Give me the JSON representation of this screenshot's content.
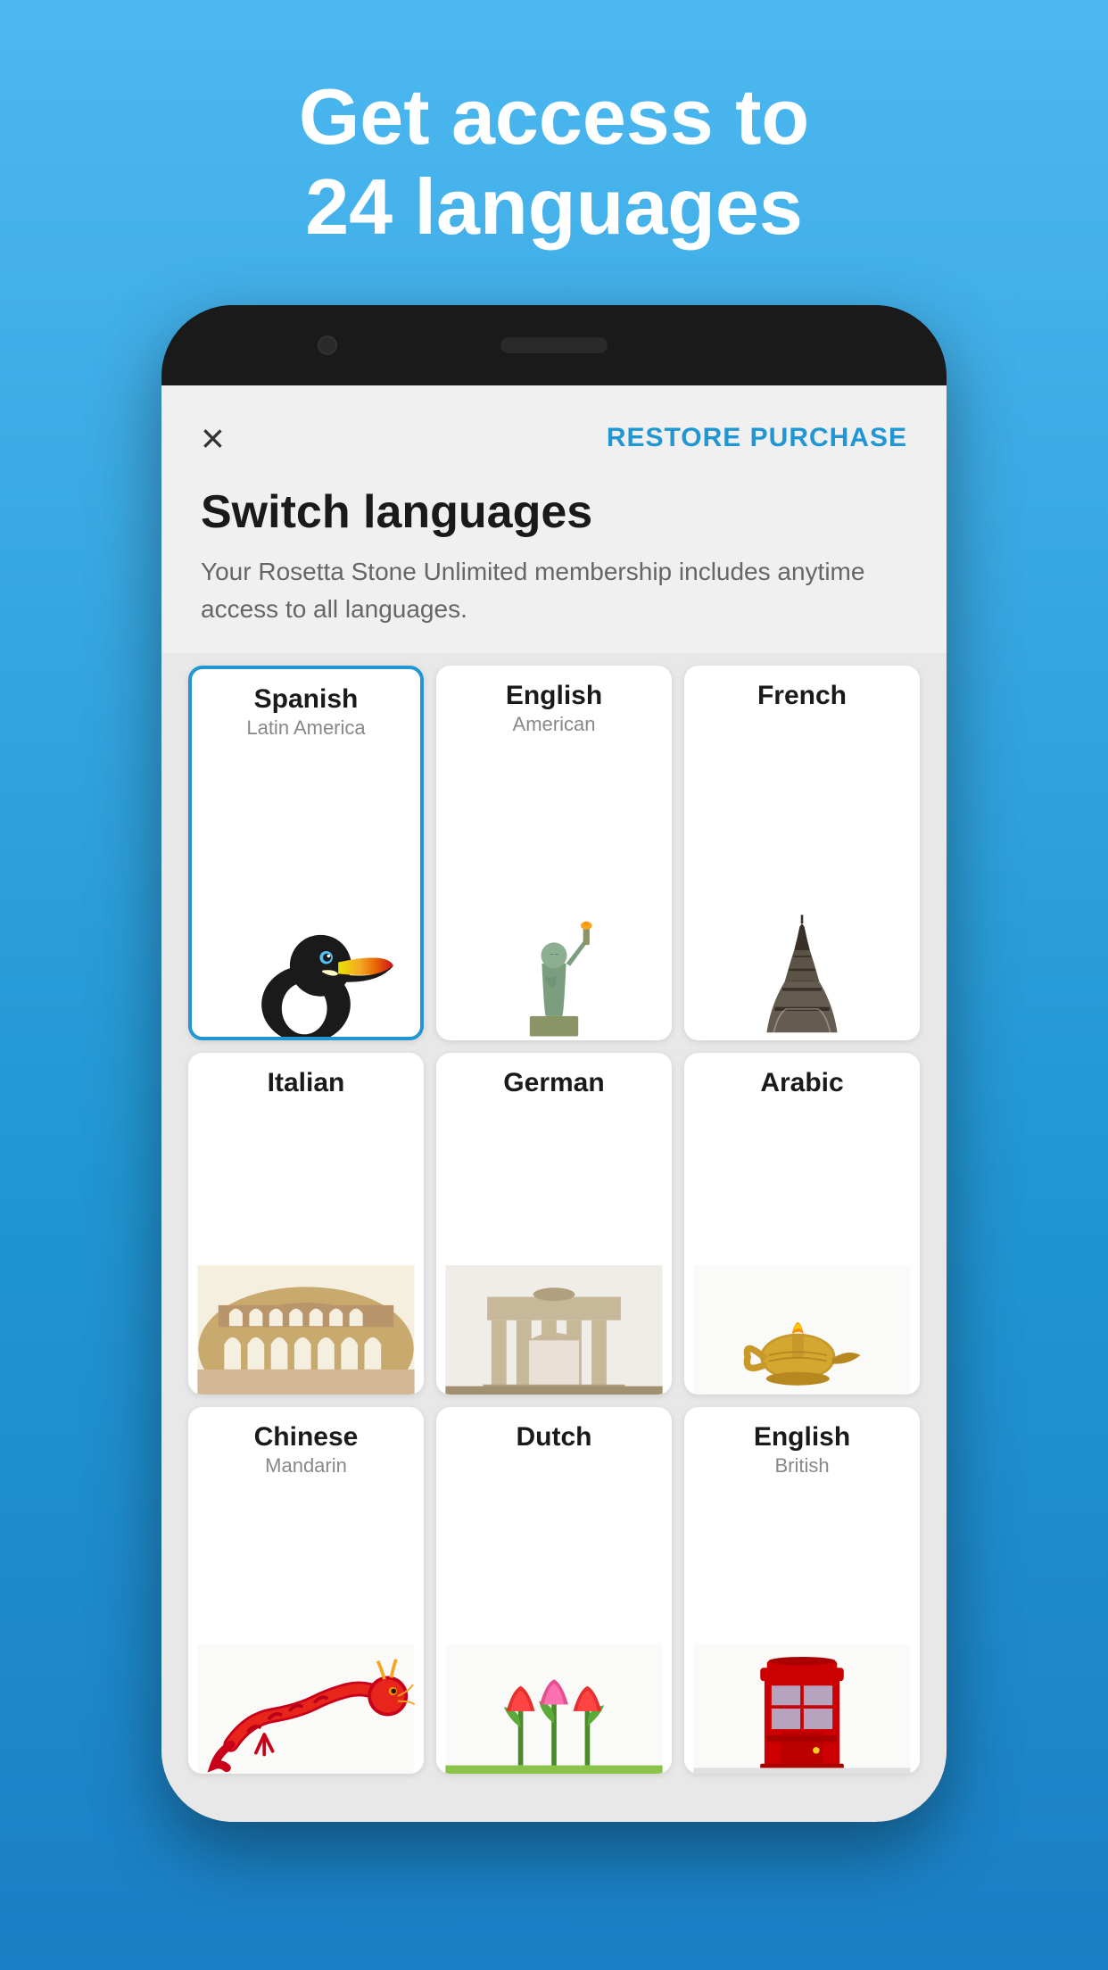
{
  "page": {
    "headline_line1": "Get access to",
    "headline_line2": "24 languages"
  },
  "header": {
    "close_icon": "×",
    "restore_label": "RESTORE PURCHASE"
  },
  "title_section": {
    "title": "Switch languages",
    "subtitle": "Your Rosetta Stone Unlimited membership includes anytime access to all languages."
  },
  "languages": [
    {
      "name": "Spanish",
      "sub": "Latin America",
      "selected": true,
      "key": "spanish"
    },
    {
      "name": "English",
      "sub": "American",
      "selected": false,
      "key": "english"
    },
    {
      "name": "French",
      "sub": "",
      "selected": false,
      "key": "french"
    },
    {
      "name": "Italian",
      "sub": "",
      "selected": false,
      "key": "italian"
    },
    {
      "name": "German",
      "sub": "",
      "selected": false,
      "key": "german"
    },
    {
      "name": "Arabic",
      "sub": "",
      "selected": false,
      "key": "arabic"
    },
    {
      "name": "Chinese",
      "sub": "Mandarin",
      "selected": false,
      "key": "chinese"
    },
    {
      "name": "Dutch",
      "sub": "",
      "selected": false,
      "key": "dutch"
    },
    {
      "name": "English",
      "sub": "British",
      "selected": false,
      "key": "english-british"
    }
  ]
}
